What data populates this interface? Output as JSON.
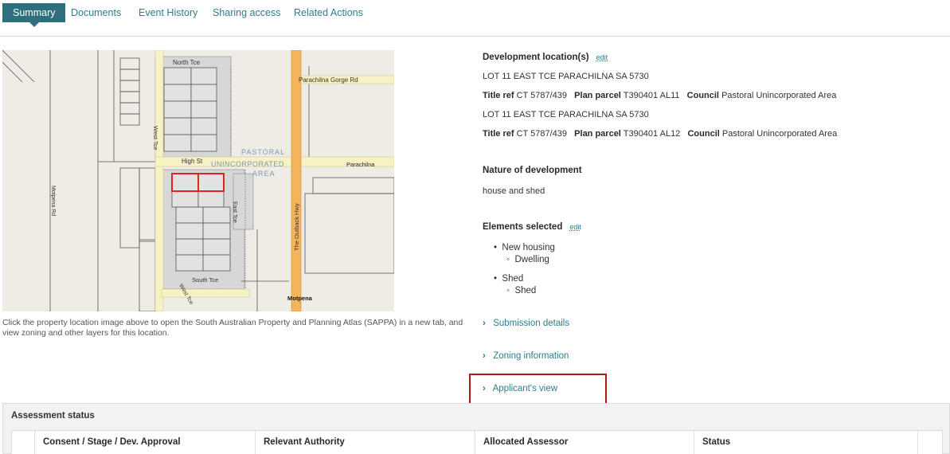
{
  "tabs": [
    {
      "label": "Summary"
    },
    {
      "label": "Documents"
    },
    {
      "label": "Event History"
    },
    {
      "label": "Sharing access"
    },
    {
      "label": "Related Actions"
    }
  ],
  "map": {
    "labels": {
      "north_tce": "North Tce",
      "parachilna_gorge_rd": "Parachilna Gorge Rd",
      "west_tce": "West Tce",
      "high_st": "High St",
      "pastoral": "PASTORAL",
      "unincorporated": "UNINCORPORATED",
      "area": "AREA",
      "parachilna": "Parachilna",
      "the_outback_hwy": "The Outback Hwy",
      "motpena_rd": "Motpena Rd",
      "east_tce": "East Tce",
      "south_tce": "South Tce",
      "west_tce_2": "West Tce",
      "motpena": "Motpena"
    },
    "caption": "Click the property location image above to open the South Australian Property and Planning Atlas (SAPPA) in a new tab, and view zoning and other layers for this location."
  },
  "development": {
    "heading": "Development location(s)",
    "edit": "edit",
    "locations": [
      {
        "address": "LOT 11 EAST TCE PARACHILNA SA 5730",
        "title_ref_label": "Title ref",
        "title_ref": "CT 5787/439",
        "plan_parcel_label": "Plan parcel",
        "plan_parcel": "T390401 AL11",
        "council_label": "Council",
        "council": "Pastoral Unincorporated Area"
      },
      {
        "address": "LOT 11 EAST TCE PARACHILNA SA 5730",
        "title_ref_label": "Title ref",
        "title_ref": "CT 5787/439",
        "plan_parcel_label": "Plan parcel",
        "plan_parcel": "T390401 AL12",
        "council_label": "Council",
        "council": "Pastoral Unincorporated Area"
      }
    ]
  },
  "nature": {
    "heading": "Nature of development",
    "value": "house and shed"
  },
  "elements": {
    "heading": "Elements selected",
    "edit": "edit",
    "items": [
      {
        "label": "New housing",
        "sub": "Dwelling"
      },
      {
        "label": "Shed",
        "sub": "Shed"
      }
    ]
  },
  "expanders": {
    "submission": "Submission details",
    "zoning": "Zoning information",
    "applicant": "Applicant's view"
  },
  "assessment": {
    "title": "Assessment status",
    "columns": [
      "Consent / Stage / Dev. Approval",
      "Relevant Authority",
      "Allocated Assessor",
      "Status"
    ]
  },
  "colors": {
    "accent": "#2e6f7d",
    "link": "#2f7d8c",
    "highlight": "#b0191b"
  }
}
